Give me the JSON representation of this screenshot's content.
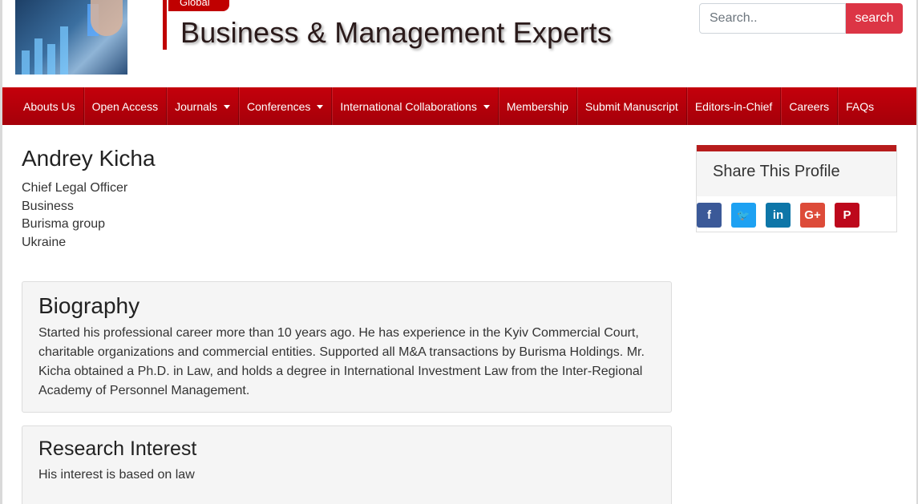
{
  "header": {
    "tag": "Global",
    "site_title": "Business & Management Experts",
    "search": {
      "placeholder": "Search..",
      "button_label": "search"
    }
  },
  "nav": {
    "items": [
      {
        "label": "Abouts Us",
        "dropdown": false
      },
      {
        "label": "Open Access",
        "dropdown": false
      },
      {
        "label": "Journals",
        "dropdown": true
      },
      {
        "label": "Conferences",
        "dropdown": true
      },
      {
        "label": "International Collaborations",
        "dropdown": true
      },
      {
        "label": "Membership",
        "dropdown": false
      },
      {
        "label": "Submit Manuscript",
        "dropdown": false
      },
      {
        "label": "Editors-in-Chief",
        "dropdown": false
      },
      {
        "label": "Careers",
        "dropdown": false
      },
      {
        "label": "FAQs",
        "dropdown": false
      }
    ]
  },
  "profile": {
    "name": "Andrey Kicha",
    "title": "Chief Legal Officer",
    "field": "Business",
    "organization": "Burisma group",
    "country": "Ukraine"
  },
  "biography": {
    "heading": "Biography",
    "text": " Started his professional career more than 10 years ago. He has experience in the Kyiv Commercial Court, charitable organizations and commercial entities. Supported all M&A transactions by Burisma Holdings. Mr. Kicha obtained a Ph.D. in Law, and holds a degree in International Investment Law from the Inter-Regional Academy of Personnel Management."
  },
  "research": {
    "heading": "Research Interest",
    "text": " His interest is based on law"
  },
  "share": {
    "heading": "Share This Profile",
    "icons": [
      {
        "name": "facebook-icon",
        "glyph": "f",
        "color": "#3b5998"
      },
      {
        "name": "twitter-icon",
        "glyph": "🐦",
        "color": "#1da1f2"
      },
      {
        "name": "linkedin-icon",
        "glyph": "in",
        "color": "#0e76a8"
      },
      {
        "name": "google-plus-icon",
        "glyph": "G+",
        "color": "#dd4b39"
      },
      {
        "name": "pinterest-icon",
        "glyph": "P",
        "color": "#bd081c"
      }
    ]
  },
  "colors": {
    "brand_red": "#c4000b",
    "search_button": "#dc3545",
    "card_bg": "#f5f5f5"
  }
}
